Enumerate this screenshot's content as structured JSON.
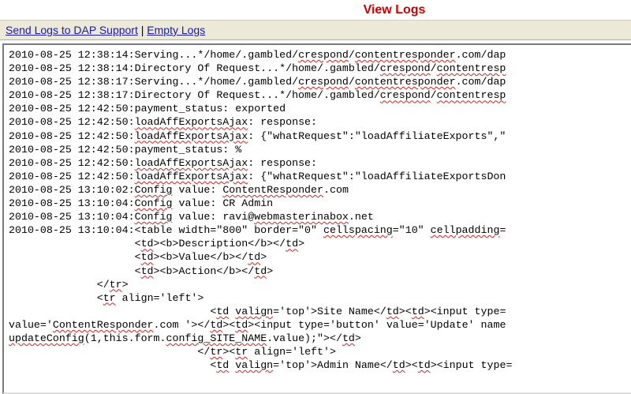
{
  "page": {
    "title": "View Logs"
  },
  "actions": {
    "send_logs": "Send Logs to DAP Support",
    "separator": "|",
    "empty_logs": "Empty Logs"
  },
  "colors": {
    "title": "#cc0000",
    "link": "#1a1aa6",
    "header_bar": "#ece9d8"
  },
  "log_lines": [
    "2010-08-25 12:38:14:Serving...*/home/.gambled/crespond/contentresponder.com/dap",
    "2010-08-25 12:38:14:Directory Of Request...*/home/.gambled/crespond/contentresp",
    "2010-08-25 12:38:17:Serving...*/home/.gambled/crespond/contentresponder.com/dap",
    "2010-08-25 12:38:17:Directory Of Request...*/home/.gambled/crespond/contentresp",
    "2010-08-25 12:42:50:payment_status: exported",
    "2010-08-25 12:42:50:loadAffExportsAjax: response:",
    "2010-08-25 12:42:50:loadAffExportsAjax: {\"whatRequest\":\"loadAffiliateExports\",\"",
    "2010-08-25 12:42:50:payment_status: %",
    "2010-08-25 12:42:50:loadAffExportsAjax: response:",
    "2010-08-25 12:42:50:loadAffExportsAjax: {\"whatRequest\":\"loadAffiliateExportsDon",
    "2010-08-25 13:10:02:Config value: ContentResponder.com",
    "2010-08-25 13:10:04:Config value: CR Admin",
    "2010-08-25 13:10:04:Config value: ravi@webmasterinabox.net",
    "2010-08-25 13:10:04:<table width=\"800\" border=\"0\" cellspacing=\"10\" cellpadding=",
    "                    <td><b>Description</b></td>",
    "                    <td><b>Value</b></td>",
    "                    <td><b>Action</b></td>",
    "              </tr>",
    "              <tr align='left'>",
    "                                <td valign='top'>Site Name</td><td><input type=",
    "value='ContentResponder.com '></td><td><input type='button' value='Update' name",
    "updateConfig(1,this.form.config_SITE_NAME.value);\"></td>",
    "                              </tr><tr align='left'>",
    "                                <td valign='top'>Admin Name</td><td><input type="
  ]
}
